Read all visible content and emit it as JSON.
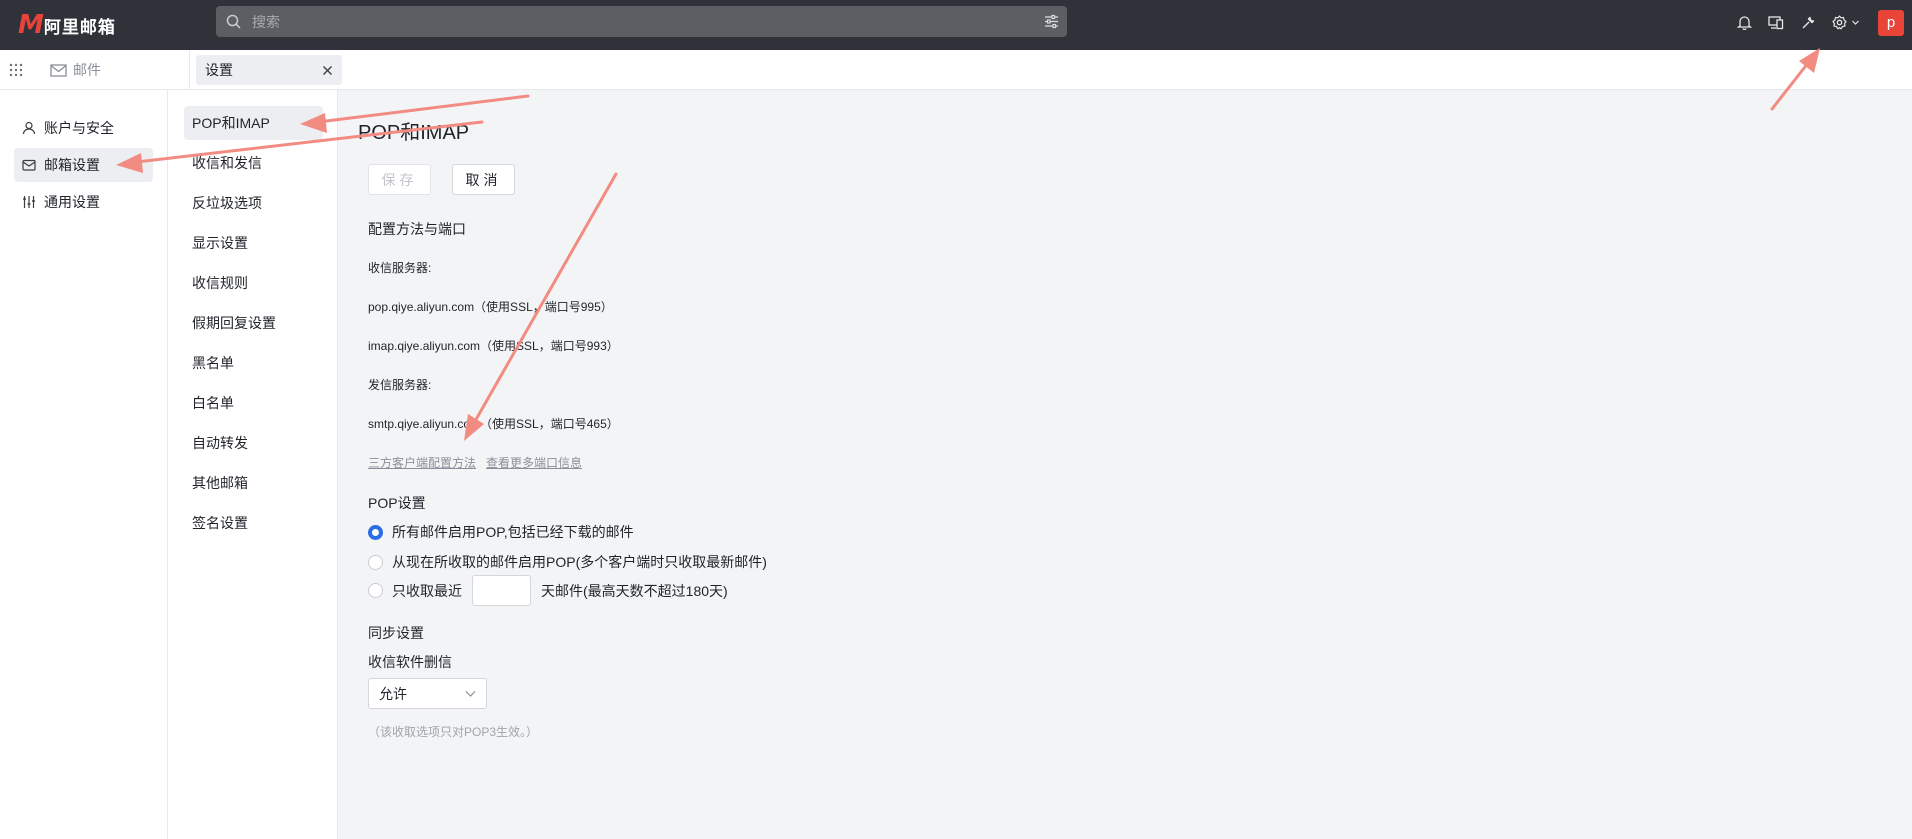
{
  "app": {
    "logo_mark": "M",
    "logo_text": "阿里邮箱",
    "avatar_letter": "p"
  },
  "search": {
    "placeholder": "搜索"
  },
  "tabs": {
    "mail_label": "邮件",
    "settings_label": "设置"
  },
  "left_nav": {
    "items": [
      {
        "label": "账户与安全",
        "icon": "user-icon"
      },
      {
        "label": "邮箱设置",
        "icon": "mailbox-settings-icon",
        "active": true
      },
      {
        "label": "通用设置",
        "icon": "sliders-icon"
      }
    ]
  },
  "sub_nav": {
    "items": [
      "POP和IMAP",
      "收信和发信",
      "反垃圾选项",
      "显示设置",
      "收信规则",
      "假期回复设置",
      "黑名单",
      "白名单",
      "自动转发",
      "其他邮箱",
      "签名设置"
    ],
    "active_index": 0
  },
  "main": {
    "title": "POP和IMAP",
    "save_label": "保存",
    "cancel_label": "取消",
    "config_heading": "配置方法与端口",
    "incoming_label": "收信服务器:",
    "pop_server": "pop.qiye.aliyun.com（使用SSL，端口号995）",
    "imap_server": "imap.qiye.aliyun.com（使用SSL，端口号993）",
    "outgoing_label": "发信服务器:",
    "smtp_server": "smtp.qiye.aliyun.com（使用SSL，端口号465）",
    "link_client_config": "三方客户端配置方法",
    "link_more_ports": "查看更多端口信息",
    "pop_heading": "POP设置",
    "pop_options": [
      {
        "label": "所有邮件启用POP,包括已经下载的邮件",
        "checked": true
      },
      {
        "label": "从现在所收取的邮件启用POP(多个客户端时只收取最新邮件)",
        "checked": false
      },
      {
        "label": "只收取最近",
        "checked": false,
        "suffix": "天邮件(最高天数不超过180天)"
      }
    ],
    "days_value": "",
    "sync_heading": "同步设置",
    "delete_label": "收信软件删信",
    "delete_select_value": "允许",
    "note": "（该收取选项只对POP3生效。）"
  },
  "colors": {
    "topbar_bg": "#2f3238",
    "brand_red": "#e8433a",
    "radio_blue": "#2b6de5",
    "annotation_arrow": "#f28b82"
  }
}
